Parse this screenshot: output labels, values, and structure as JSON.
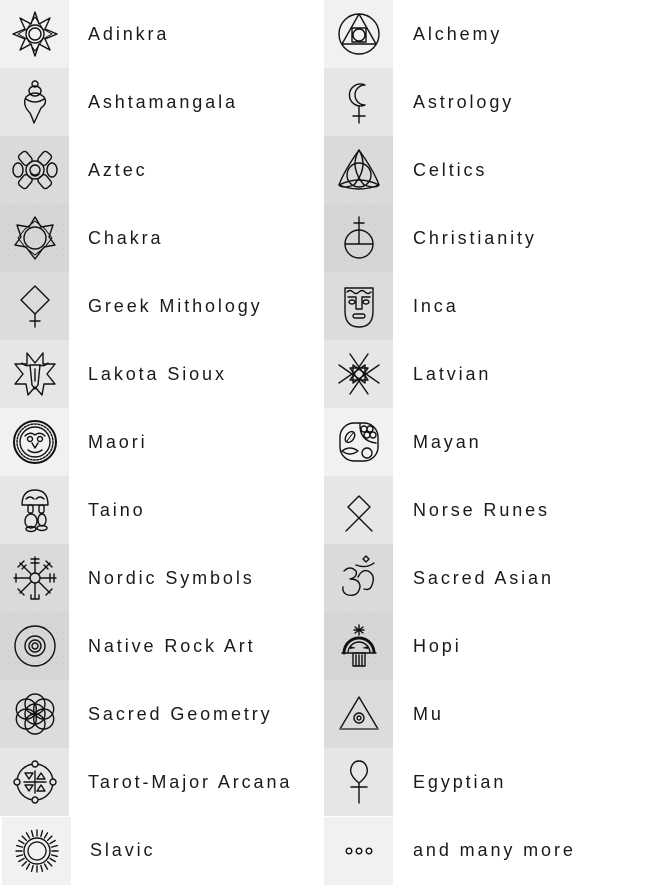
{
  "left_column": [
    {
      "label": "Adinkra",
      "icon": "adinkra-star-icon",
      "bg": "#f1f1f1"
    },
    {
      "label": "Ashtamangala",
      "icon": "conch-shell-icon",
      "bg": "#e6e6e6"
    },
    {
      "label": "Aztec",
      "icon": "aztec-flower-icon",
      "bg": "#dadada"
    },
    {
      "label": "Chakra",
      "icon": "lotus-chakra-icon",
      "bg": "#d6d6d6"
    },
    {
      "label": "Greek Mithology",
      "icon": "diamond-cross-icon",
      "bg": "#dcdcdc"
    },
    {
      "label": "Lakota Sioux",
      "icon": "buffalo-star-icon",
      "bg": "#e6e6e6"
    },
    {
      "label": "Maori",
      "icon": "maori-face-circle-icon",
      "bg": "#f1f1f1"
    },
    {
      "label": "Taino",
      "icon": "taino-figure-icon",
      "bg": "#e6e6e6"
    },
    {
      "label": "Nordic Symbols",
      "icon": "vegvisir-icon",
      "bg": "#dadada"
    },
    {
      "label": "Native Rock Art",
      "icon": "concentric-circles-icon",
      "bg": "#d6d6d6"
    },
    {
      "label": "Sacred Geometry",
      "icon": "flower-of-life-icon",
      "bg": "#dcdcdc"
    },
    {
      "label": "Tarot-Major Arcana",
      "icon": "tarot-elements-circle-icon",
      "bg": "#e6e6e6"
    },
    {
      "label": "Slavic",
      "icon": "slavic-sun-icon",
      "bg": "#f1f1f1"
    }
  ],
  "right_column": [
    {
      "label": "Alchemy",
      "icon": "squared-circle-icon",
      "bg": "#f1f1f1"
    },
    {
      "label": "Astrology",
      "icon": "moon-cross-icon",
      "bg": "#e6e6e6"
    },
    {
      "label": "Celtics",
      "icon": "triquetra-icon",
      "bg": "#dadada"
    },
    {
      "label": "Christianity",
      "icon": "globus-cruciger-icon",
      "bg": "#d6d6d6"
    },
    {
      "label": "Inca",
      "icon": "inca-mask-icon",
      "bg": "#dcdcdc"
    },
    {
      "label": "Latvian",
      "icon": "auseklis-star-icon",
      "bg": "#e6e6e6"
    },
    {
      "label": "Mayan",
      "icon": "mayan-glyph-icon",
      "bg": "#f1f1f1"
    },
    {
      "label": "Norse Runes",
      "icon": "othala-rune-icon",
      "bg": "#e6e6e6"
    },
    {
      "label": "Sacred Asian",
      "icon": "om-icon",
      "bg": "#dadada"
    },
    {
      "label": "Hopi",
      "icon": "hopi-sun-face-icon",
      "bg": "#d6d6d6"
    },
    {
      "label": "Mu",
      "icon": "eye-triangle-icon",
      "bg": "#dcdcdc"
    },
    {
      "label": "Egyptian",
      "icon": "ankh-icon",
      "bg": "#e6e6e6"
    },
    {
      "label": "and many more",
      "icon": "ellipsis-icon",
      "bg": "#f1f1f1"
    }
  ]
}
